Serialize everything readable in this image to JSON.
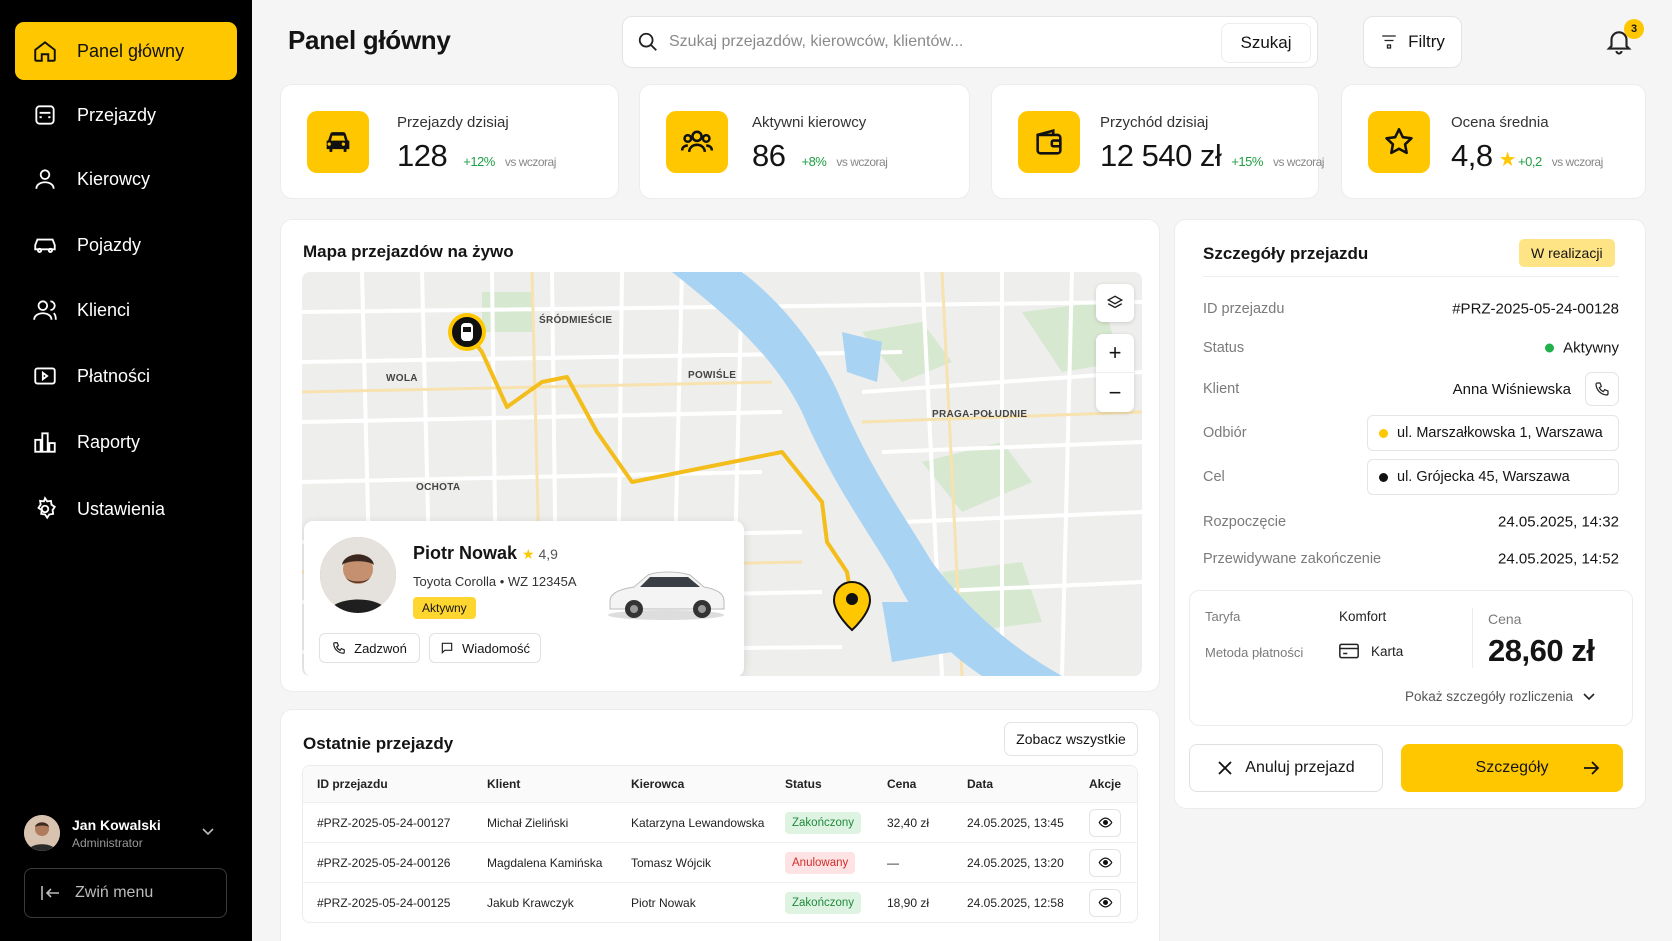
{
  "sidebar": {
    "items": [
      {
        "label": "Panel główny",
        "icon": "home-icon",
        "active": true
      },
      {
        "label": "Przejazdy",
        "icon": "car-icon"
      },
      {
        "label": "Kierowcy",
        "icon": "users-icon"
      },
      {
        "label": "Pojazdy",
        "icon": "vehicle-icon"
      },
      {
        "label": "Klienci",
        "icon": "clients-icon"
      },
      {
        "label": "Płatności",
        "icon": "payments-icon"
      },
      {
        "label": "Raporty",
        "icon": "reports-icon"
      },
      {
        "label": "Ustawienia",
        "icon": "gear-icon"
      }
    ],
    "user": {
      "name": "Jan Kowalski",
      "role": "Administrator"
    },
    "collapse_label": "Zwiń menu"
  },
  "header": {
    "title": "Panel główny",
    "search_placeholder": "Szukaj przejazdów, kierowców, klientów...",
    "search_button": "Szukaj",
    "filters_label": "Filtry",
    "notifications_count": "3"
  },
  "kpis": [
    {
      "label": "Przejazdy dzisiaj",
      "value": "128",
      "delta": "+12%",
      "vs": "vs wczoraj",
      "icon": "car-icon"
    },
    {
      "label": "Aktywni kierowcy",
      "value": "86",
      "delta": "+8%",
      "vs": "vs wczoraj",
      "icon": "users-icon"
    },
    {
      "label": "Przychód dzisiaj",
      "value": "12 540 zł",
      "delta": "+15%",
      "vs": "vs wczoraj",
      "icon": "wallet-icon"
    },
    {
      "label": "Ocena średnia",
      "value": "4,8",
      "delta": "+0,2",
      "vs": "vs wczoraj",
      "icon": "star-icon"
    }
  ],
  "map": {
    "title": "Mapa przejazdów na żywo",
    "labels": [
      "ŚRÓDMIEŚCIE",
      "WOLA",
      "POWIŚLE",
      "PRAGA-POŁUDNIE",
      "OCHOTA"
    ]
  },
  "driver": {
    "name": "Piotr Nowak",
    "rating": "4,9",
    "car": "Toyota Corolla • WZ 12345A",
    "status": "Aktywny",
    "call_label": "Zadzwoń",
    "message_label": "Wiadomość"
  },
  "recent": {
    "title": "Ostatnie przejazdy",
    "see_all": "Zobacz wszystkie",
    "columns": [
      "ID przejazdu",
      "Klient",
      "Kierowca",
      "Status",
      "Cena",
      "Data",
      "Akcje"
    ],
    "rows": [
      {
        "id": "#PRZ-2025-05-24-00127",
        "client": "Michał Zieliński",
        "driver": "Katarzyna Lewandowska",
        "status": "Zakończony",
        "status_type": "done",
        "price": "32,40 zł",
        "date": "24.05.2025, 13:45"
      },
      {
        "id": "#PRZ-2025-05-24-00126",
        "client": "Magdalena Kamińska",
        "driver": "Tomasz Wójcik",
        "status": "Anulowany",
        "status_type": "cancel",
        "price": "—",
        "date": "24.05.2025, 13:20"
      },
      {
        "id": "#PRZ-2025-05-24-00125",
        "client": "Jakub Krawczyk",
        "driver": "Piotr Nowak",
        "status": "Zakończony",
        "status_type": "done",
        "price": "18,90 zł",
        "date": "24.05.2025, 12:58"
      }
    ]
  },
  "details": {
    "title": "Szczegóły przejazdu",
    "badge": "W realizacji",
    "id_label": "ID przejazdu",
    "id_value": "#PRZ-2025-05-24-00128",
    "status_label": "Status",
    "status_value": "Aktywny",
    "client_label": "Klient",
    "client_value": "Anna Wiśniewska",
    "pickup_label": "Odbiór",
    "pickup_value": "ul. Marszałkowska 1, Warszawa",
    "dest_label": "Cel",
    "dest_value": "ul. Grójecka 45, Warszawa",
    "start_label": "Rozpoczęcie",
    "start_value": "24.05.2025, 14:32",
    "end_label": "Przewidywane zakończenie",
    "end_value": "24.05.2025, 14:52",
    "tariff_label": "Taryfa",
    "tariff_value": "Komfort",
    "payment_label": "Metoda płatności",
    "payment_value": "Karta",
    "price_label": "Cena",
    "price_value": "28,60 zł",
    "breakdown_label": "Pokaż szczegóły rozliczenia",
    "cancel_label": "Anuluj przejazd",
    "details_label": "Szczegóły"
  },
  "colors": {
    "accent": "#FFC700",
    "sidebar_bg": "#000000",
    "success": "#1e9e44",
    "danger": "#d22c2c"
  }
}
